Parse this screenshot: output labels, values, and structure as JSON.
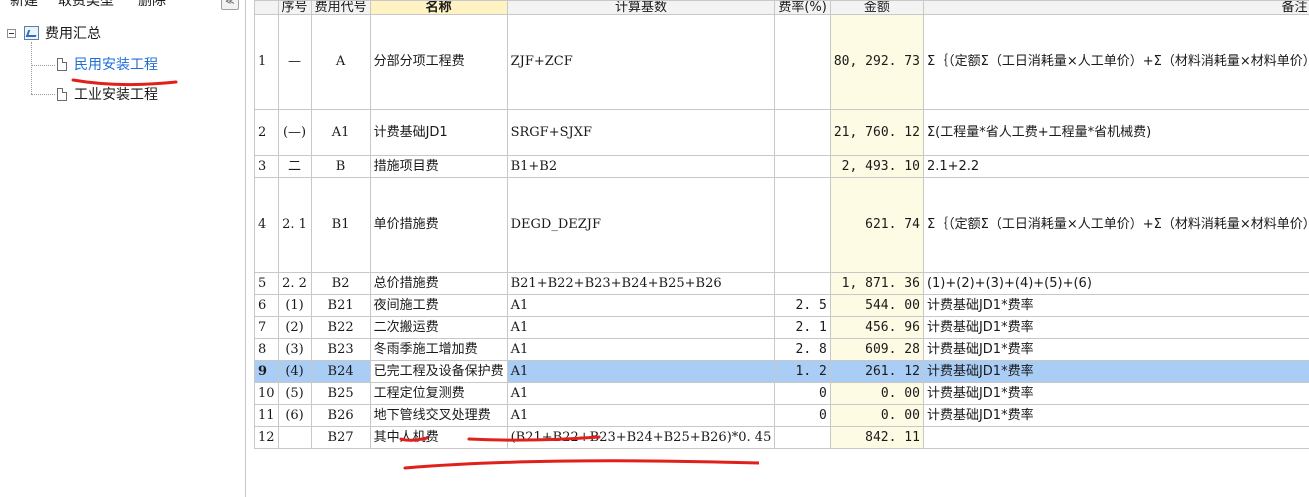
{
  "toolbar": {
    "new_label": "新建",
    "fee_type_label": "取费类型",
    "delete_label": "删除",
    "collapse_label": "≪"
  },
  "tree": {
    "root": "费用汇总",
    "children": [
      "民用安装工程",
      "工业安装工程"
    ]
  },
  "columns": [
    "序号",
    "费用代号",
    "名称",
    "计算基数",
    "费率(%)",
    "金额",
    "备注"
  ],
  "rows": [
    {
      "idx": "1",
      "seq": "—",
      "code": "A",
      "name": "分部分项工程费",
      "formula": "ZJF+ZCF",
      "rate": "",
      "amount": "80, 292. 73",
      "note": "Σ｛（定额Σ（工日消耗量×人工单价）+Σ（材料消耗量×材料单价）+Σ（机械台班消耗量×台班单价））×分部分项工程量｝"
    },
    {
      "idx": "2",
      "seq": "(—)",
      "code": "A1",
      "name": "计费基础JD1",
      "formula": "SRGF+SJXF",
      "rate": "",
      "amount": "21, 760. 12",
      "note": "Σ(工程量*省人工费+工程量*省机械费)"
    },
    {
      "idx": "3",
      "seq": "二",
      "code": "B",
      "name": "措施项目费",
      "formula": "B1+B2",
      "rate": "",
      "amount": "2, 493. 10",
      "note": "2.1+2.2"
    },
    {
      "idx": "4",
      "seq": "2. 1",
      "code": "B1",
      "name": "单价措施费",
      "formula": "DEGD_DEZJF",
      "rate": "",
      "amount": "621. 74",
      "note": "Σ｛（定额Σ（工日消耗量×人工单价）+Σ（材料消耗量×材料单价）+Σ（机械台班消耗量×台班单价））×单价措施项目工程量｝"
    },
    {
      "idx": "5",
      "seq": "2. 2",
      "code": "B2",
      "name": "总价措施费",
      "formula": "B21+B22+B23+B24+B25+B26",
      "rate": "",
      "amount": "1, 871. 36",
      "note": "(1)+(2)+(3)+(4)+(5)+(6)"
    },
    {
      "idx": "6",
      "seq": "(1)",
      "code": "B21",
      "name": "夜间施工费",
      "formula": "A1",
      "rate": "2. 5",
      "amount": "544. 00",
      "note": "计费基础JD1*费率"
    },
    {
      "idx": "7",
      "seq": "(2)",
      "code": "B22",
      "name": "二次搬运费",
      "formula": "A1",
      "rate": "2. 1",
      "amount": "456. 96",
      "note": "计费基础JD1*费率"
    },
    {
      "idx": "8",
      "seq": "(3)",
      "code": "B23",
      "name": "冬雨季施工增加费",
      "formula": "A1",
      "rate": "2. 8",
      "amount": "609. 28",
      "note": "计费基础JD1*费率"
    },
    {
      "idx": "9",
      "seq": "(4)",
      "code": "B24",
      "name": "已完工程及设备保护费",
      "formula": "A1",
      "rate": "1. 2",
      "amount": "261. 12",
      "note": "计费基础JD1*费率"
    },
    {
      "idx": "10",
      "seq": "(5)",
      "code": "B25",
      "name": "工程定位复测费",
      "formula": "A1",
      "rate": "0",
      "amount": "0. 00",
      "note": "计费基础JD1*费率"
    },
    {
      "idx": "11",
      "seq": "(6)",
      "code": "B26",
      "name": "地下管线交叉处理费",
      "formula": "A1",
      "rate": "0",
      "amount": "0. 00",
      "note": "计费基础JD1*费率"
    },
    {
      "idx": "12",
      "seq": "",
      "code": "B27",
      "name": "其中人机费",
      "formula": "(B21+B22+B23+B24+B25+B26)*0. 45",
      "rate": "",
      "amount": "842. 11",
      "note": ""
    }
  ],
  "selected_row": 9,
  "colors": {
    "selection": "#a9cdf5",
    "amount_bg": "#fdfbe4",
    "link": "#1f6fd6",
    "annotation": "#e0201a"
  }
}
